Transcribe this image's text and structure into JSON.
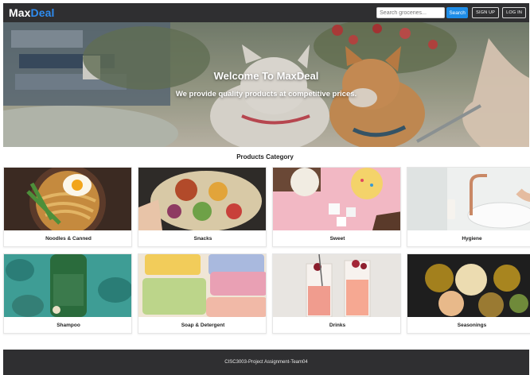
{
  "navbar": {
    "brand_part1": "Max",
    "brand_part2": "Deal",
    "search_placeholder": "Search groceries...",
    "search_label": "Search",
    "signup_label": "SIGN UP",
    "login_label": "LOG IN"
  },
  "hero": {
    "title": "Welcome To MaxDeal",
    "subtitle": "We provide quality products at competitive prices."
  },
  "section": {
    "title": "Products Category"
  },
  "categories": [
    {
      "label": "Noodles & Canned"
    },
    {
      "label": "Snacks"
    },
    {
      "label": "Sweet"
    },
    {
      "label": "Hygiene"
    },
    {
      "label": "Shampoo"
    },
    {
      "label": "Soap & Detergent"
    },
    {
      "label": "Drinks"
    },
    {
      "label": "Seasonings"
    }
  ],
  "footer": {
    "text": "CISC3003-Project Assignment-Team04"
  },
  "colors": {
    "nav_bg": "#2f2f31",
    "brand_accent": "#2f8cf0",
    "search_button": "#1e8de8"
  }
}
